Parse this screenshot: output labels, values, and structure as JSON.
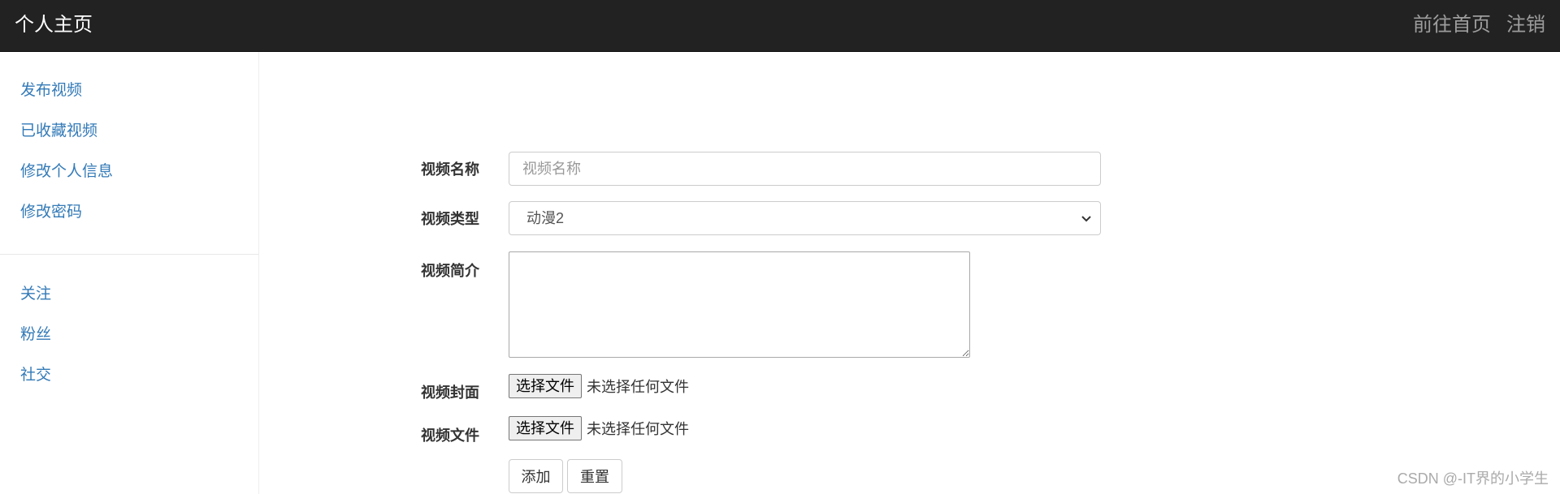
{
  "navbar": {
    "brand": "个人主页",
    "links": [
      "前往首页",
      "注销"
    ]
  },
  "sidebar": {
    "group1": [
      "发布视频",
      "已收藏视频",
      "修改个人信息",
      "修改密码"
    ],
    "group2": [
      "关注",
      "粉丝",
      "社交"
    ]
  },
  "form": {
    "name_label": "视频名称",
    "name_placeholder": "视频名称",
    "name_value": "",
    "type_label": "视频类型",
    "type_value": "动漫2",
    "intro_label": "视频简介",
    "intro_value": "",
    "cover_label": "视频封面",
    "cover_button": "选择文件",
    "cover_status": "未选择任何文件",
    "file_label": "视频文件",
    "file_button": "选择文件",
    "file_status": "未选择任何文件",
    "add_button": "添加",
    "reset_button": "重置"
  },
  "watermark": "CSDN @-IT界的小学生",
  "colors": {
    "navbar_bg": "#222222",
    "brand_text": "#ffffff",
    "nav_link": "#9d9d9d",
    "sidebar_link": "#337ab7"
  }
}
